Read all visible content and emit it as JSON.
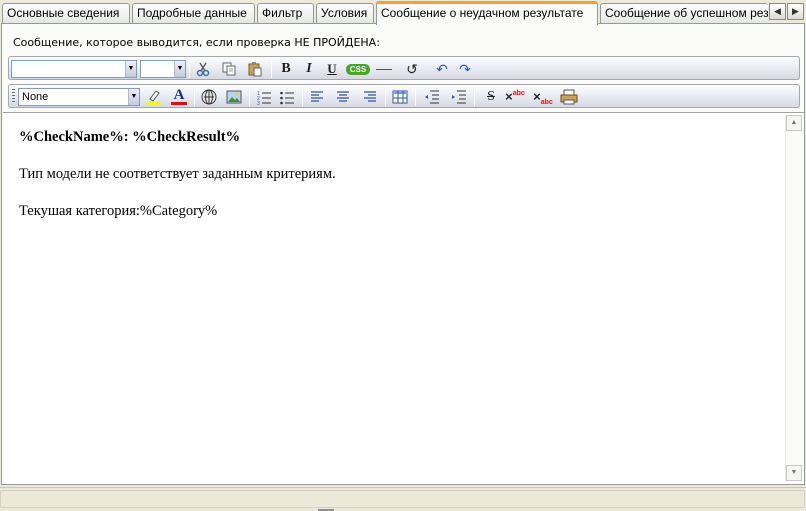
{
  "tabs": [
    {
      "label": "Основные сведения",
      "active": false
    },
    {
      "label": "Подробные данные",
      "active": false
    },
    {
      "label": "Фильтр",
      "active": false
    },
    {
      "label": "Условия",
      "active": false
    },
    {
      "label": "Сообщение о неудачном результате",
      "active": true
    },
    {
      "label": "Сообщение об успешном рез",
      "active": false
    }
  ],
  "tab_scroll": {
    "left_icon": "arrow-left-icon",
    "right_icon": "arrow-right-icon"
  },
  "prompt_label": "Сообщение, которое выводится, если проверка НЕ ПРОЙДЕНА:",
  "toolbar1": {
    "font_name": "",
    "font_size": "",
    "buttons": [
      "cut-icon",
      "copy-icon",
      "paste-icon",
      "bold-icon",
      "italic-icon",
      "underline-icon",
      "css-icon",
      "horizontal-rule-icon",
      "refresh-icon",
      "undo-icon",
      "redo-icon"
    ],
    "bold_label": "B",
    "italic_label": "I",
    "underline_label": "U",
    "css_label": "CSS"
  },
  "toolbar2": {
    "style_value": "None",
    "buttons": [
      "highlight-icon",
      "font-color-icon",
      "hyperlink-icon",
      "image-icon",
      "ordered-list-icon",
      "unordered-list-icon",
      "align-left-icon",
      "align-center-icon",
      "align-right-icon",
      "table-icon",
      "outdent-icon",
      "indent-icon",
      "strikethrough-icon",
      "superscript-icon",
      "subscript-icon",
      "print-icon"
    ],
    "font_color_label": "A"
  },
  "editor": {
    "lines": [
      {
        "text": "%CheckName%: %CheckResult%",
        "bold": true
      },
      {
        "text": "Тип модели не соответствует заданным критериям.",
        "bold": false
      },
      {
        "text": "Текушая категория:%Category%",
        "bold": false
      }
    ]
  },
  "colors": {
    "active_tab_accent": "#f3a32b",
    "css_badge": "#4aa629",
    "highlight": "#f7f12a",
    "font_color": "#e01010"
  }
}
